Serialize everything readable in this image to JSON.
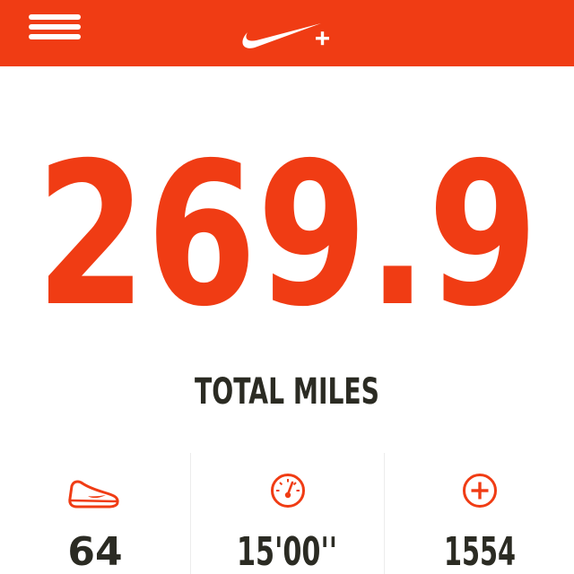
{
  "colors": {
    "accent": "#f03c14",
    "text_dark": "#2b2b23",
    "background": "#ffffff"
  },
  "header": {
    "menu_icon": "hamburger-menu-icon",
    "logo": "nike-plus-logo"
  },
  "summary": {
    "total": "269.9",
    "total_label": "TOTAL MILES"
  },
  "stats": [
    {
      "icon": "running-shoe-icon",
      "value": "64"
    },
    {
      "icon": "speedometer-icon",
      "value": "15'00''"
    },
    {
      "icon": "nike-fuel-plus-icon",
      "value": "1554"
    }
  ]
}
